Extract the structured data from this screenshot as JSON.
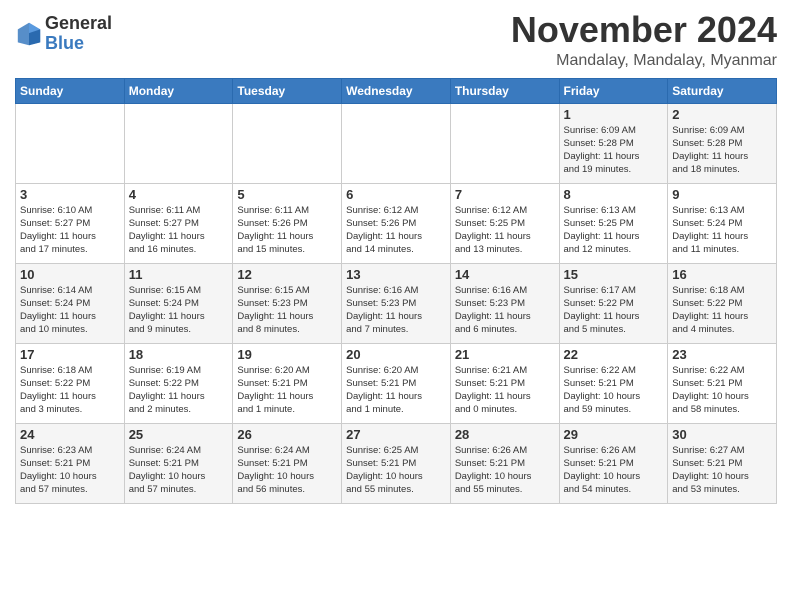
{
  "logo": {
    "general": "General",
    "blue": "Blue"
  },
  "header": {
    "month": "November 2024",
    "location": "Mandalay, Mandalay, Myanmar"
  },
  "weekdays": [
    "Sunday",
    "Monday",
    "Tuesday",
    "Wednesday",
    "Thursday",
    "Friday",
    "Saturday"
  ],
  "weeks": [
    [
      {
        "day": "",
        "info": ""
      },
      {
        "day": "",
        "info": ""
      },
      {
        "day": "",
        "info": ""
      },
      {
        "day": "",
        "info": ""
      },
      {
        "day": "",
        "info": ""
      },
      {
        "day": "1",
        "info": "Sunrise: 6:09 AM\nSunset: 5:28 PM\nDaylight: 11 hours\nand 19 minutes."
      },
      {
        "day": "2",
        "info": "Sunrise: 6:09 AM\nSunset: 5:28 PM\nDaylight: 11 hours\nand 18 minutes."
      }
    ],
    [
      {
        "day": "3",
        "info": "Sunrise: 6:10 AM\nSunset: 5:27 PM\nDaylight: 11 hours\nand 17 minutes."
      },
      {
        "day": "4",
        "info": "Sunrise: 6:11 AM\nSunset: 5:27 PM\nDaylight: 11 hours\nand 16 minutes."
      },
      {
        "day": "5",
        "info": "Sunrise: 6:11 AM\nSunset: 5:26 PM\nDaylight: 11 hours\nand 15 minutes."
      },
      {
        "day": "6",
        "info": "Sunrise: 6:12 AM\nSunset: 5:26 PM\nDaylight: 11 hours\nand 14 minutes."
      },
      {
        "day": "7",
        "info": "Sunrise: 6:12 AM\nSunset: 5:25 PM\nDaylight: 11 hours\nand 13 minutes."
      },
      {
        "day": "8",
        "info": "Sunrise: 6:13 AM\nSunset: 5:25 PM\nDaylight: 11 hours\nand 12 minutes."
      },
      {
        "day": "9",
        "info": "Sunrise: 6:13 AM\nSunset: 5:24 PM\nDaylight: 11 hours\nand 11 minutes."
      }
    ],
    [
      {
        "day": "10",
        "info": "Sunrise: 6:14 AM\nSunset: 5:24 PM\nDaylight: 11 hours\nand 10 minutes."
      },
      {
        "day": "11",
        "info": "Sunrise: 6:15 AM\nSunset: 5:24 PM\nDaylight: 11 hours\nand 9 minutes."
      },
      {
        "day": "12",
        "info": "Sunrise: 6:15 AM\nSunset: 5:23 PM\nDaylight: 11 hours\nand 8 minutes."
      },
      {
        "day": "13",
        "info": "Sunrise: 6:16 AM\nSunset: 5:23 PM\nDaylight: 11 hours\nand 7 minutes."
      },
      {
        "day": "14",
        "info": "Sunrise: 6:16 AM\nSunset: 5:23 PM\nDaylight: 11 hours\nand 6 minutes."
      },
      {
        "day": "15",
        "info": "Sunrise: 6:17 AM\nSunset: 5:22 PM\nDaylight: 11 hours\nand 5 minutes."
      },
      {
        "day": "16",
        "info": "Sunrise: 6:18 AM\nSunset: 5:22 PM\nDaylight: 11 hours\nand 4 minutes."
      }
    ],
    [
      {
        "day": "17",
        "info": "Sunrise: 6:18 AM\nSunset: 5:22 PM\nDaylight: 11 hours\nand 3 minutes."
      },
      {
        "day": "18",
        "info": "Sunrise: 6:19 AM\nSunset: 5:22 PM\nDaylight: 11 hours\nand 2 minutes."
      },
      {
        "day": "19",
        "info": "Sunrise: 6:20 AM\nSunset: 5:21 PM\nDaylight: 11 hours\nand 1 minute."
      },
      {
        "day": "20",
        "info": "Sunrise: 6:20 AM\nSunset: 5:21 PM\nDaylight: 11 hours\nand 1 minute."
      },
      {
        "day": "21",
        "info": "Sunrise: 6:21 AM\nSunset: 5:21 PM\nDaylight: 11 hours\nand 0 minutes."
      },
      {
        "day": "22",
        "info": "Sunrise: 6:22 AM\nSunset: 5:21 PM\nDaylight: 10 hours\nand 59 minutes."
      },
      {
        "day": "23",
        "info": "Sunrise: 6:22 AM\nSunset: 5:21 PM\nDaylight: 10 hours\nand 58 minutes."
      }
    ],
    [
      {
        "day": "24",
        "info": "Sunrise: 6:23 AM\nSunset: 5:21 PM\nDaylight: 10 hours\nand 57 minutes."
      },
      {
        "day": "25",
        "info": "Sunrise: 6:24 AM\nSunset: 5:21 PM\nDaylight: 10 hours\nand 57 minutes."
      },
      {
        "day": "26",
        "info": "Sunrise: 6:24 AM\nSunset: 5:21 PM\nDaylight: 10 hours\nand 56 minutes."
      },
      {
        "day": "27",
        "info": "Sunrise: 6:25 AM\nSunset: 5:21 PM\nDaylight: 10 hours\nand 55 minutes."
      },
      {
        "day": "28",
        "info": "Sunrise: 6:26 AM\nSunset: 5:21 PM\nDaylight: 10 hours\nand 55 minutes."
      },
      {
        "day": "29",
        "info": "Sunrise: 6:26 AM\nSunset: 5:21 PM\nDaylight: 10 hours\nand 54 minutes."
      },
      {
        "day": "30",
        "info": "Sunrise: 6:27 AM\nSunset: 5:21 PM\nDaylight: 10 hours\nand 53 minutes."
      }
    ]
  ]
}
